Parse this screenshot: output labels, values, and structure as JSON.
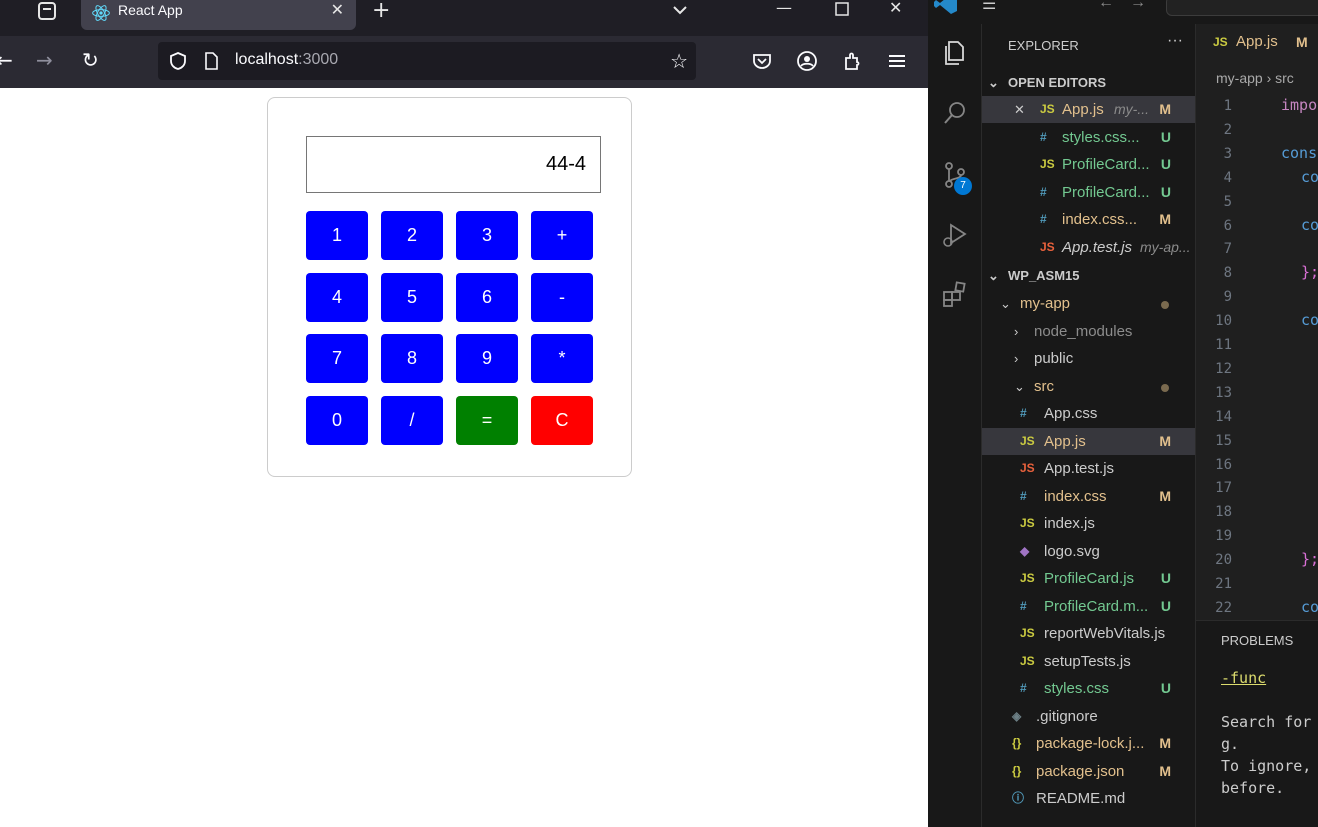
{
  "browser": {
    "tab_title": "React App",
    "url_host": "localhost",
    "url_port": ":3000"
  },
  "calculator": {
    "display_value": "44-4",
    "keys": [
      {
        "label": "1",
        "color": "#0000ff"
      },
      {
        "label": "2",
        "color": "#0000ff"
      },
      {
        "label": "3",
        "color": "#0000ff"
      },
      {
        "label": "+",
        "color": "#0000ff"
      },
      {
        "label": "4",
        "color": "#0000ff"
      },
      {
        "label": "5",
        "color": "#0000ff"
      },
      {
        "label": "6",
        "color": "#0000ff"
      },
      {
        "label": "-",
        "color": "#0000ff"
      },
      {
        "label": "7",
        "color": "#0000ff"
      },
      {
        "label": "8",
        "color": "#0000ff"
      },
      {
        "label": "9",
        "color": "#0000ff"
      },
      {
        "label": "*",
        "color": "#0000ff"
      },
      {
        "label": "0",
        "color": "#0000ff"
      },
      {
        "label": "/",
        "color": "#0000ff"
      },
      {
        "label": "=",
        "color": "#008000"
      },
      {
        "label": "C",
        "color": "#ff0000"
      }
    ]
  },
  "vscode": {
    "explorer_title": "EXPLORER",
    "source_control_badge": "7",
    "open_editors_header": "OPEN EDITORS",
    "open_editors": [
      {
        "close": "✕",
        "icon": "JS",
        "icon_color": "#cbcb41",
        "name": "App.js",
        "extra": "my-...",
        "status": "M",
        "name_color": "#e2c08d",
        "status_color": "#e2c08d"
      },
      {
        "close": "",
        "icon": "#",
        "icon_color": "#519aba",
        "name": "styles.css...",
        "extra": "",
        "status": "U",
        "name_color": "#73c991",
        "status_color": "#73c991"
      },
      {
        "close": "",
        "icon": "JS",
        "icon_color": "#cbcb41",
        "name": "ProfileCard...",
        "extra": "",
        "status": "U",
        "name_color": "#73c991",
        "status_color": "#73c991"
      },
      {
        "close": "",
        "icon": "#",
        "icon_color": "#519aba",
        "name": "ProfileCard...",
        "extra": "",
        "status": "U",
        "name_color": "#73c991",
        "status_color": "#73c991"
      },
      {
        "close": "",
        "icon": "#",
        "icon_color": "#519aba",
        "name": "index.css...",
        "extra": "",
        "status": "M",
        "name_color": "#e2c08d",
        "status_color": "#e2c08d"
      },
      {
        "close": "",
        "icon": "JS",
        "icon_color": "#e8613c",
        "name": "App.test.js",
        "extra": "my-ap...",
        "status": "",
        "name_color": "#cccccc",
        "status_color": "#cccccc"
      }
    ],
    "workspace_header": "WP_ASM15",
    "tree": [
      {
        "chev": "⌄",
        "icon": "",
        "icon_color": "#ccc",
        "name": "my-app",
        "status": "dot",
        "name_color": "#e2c08d",
        "indent": 1
      },
      {
        "chev": "›",
        "icon": "",
        "icon_color": "#ccc",
        "name": "node_modules",
        "status": "",
        "name_color": "#8c8c8c",
        "indent": 2
      },
      {
        "chev": "›",
        "icon": "",
        "icon_color": "#ccc",
        "name": "public",
        "status": "",
        "name_color": "#cccccc",
        "indent": 2
      },
      {
        "chev": "⌄",
        "icon": "",
        "icon_color": "#ccc",
        "name": "src",
        "status": "dot",
        "name_color": "#e2c08d",
        "indent": 2
      },
      {
        "chev": "",
        "icon": "#",
        "icon_color": "#519aba",
        "name": "App.css",
        "status": "",
        "name_color": "#cccccc",
        "indent": 3
      },
      {
        "chev": "",
        "icon": "JS",
        "icon_color": "#cbcb41",
        "name": "App.js",
        "status": "M",
        "name_color": "#e2c08d",
        "indent": 3
      },
      {
        "chev": "",
        "icon": "JS",
        "icon_color": "#e8613c",
        "name": "App.test.js",
        "status": "",
        "name_color": "#cccccc",
        "indent": 3
      },
      {
        "chev": "",
        "icon": "#",
        "icon_color": "#519aba",
        "name": "index.css",
        "status": "M",
        "name_color": "#e2c08d",
        "indent": 3
      },
      {
        "chev": "",
        "icon": "JS",
        "icon_color": "#cbcb41",
        "name": "index.js",
        "status": "",
        "name_color": "#cccccc",
        "indent": 3
      },
      {
        "chev": "",
        "icon": "◆",
        "icon_color": "#a074c4",
        "name": "logo.svg",
        "status": "",
        "name_color": "#cccccc",
        "indent": 3
      },
      {
        "chev": "",
        "icon": "JS",
        "icon_color": "#cbcb41",
        "name": "ProfileCard.js",
        "status": "U",
        "name_color": "#73c991",
        "indent": 3
      },
      {
        "chev": "",
        "icon": "#",
        "icon_color": "#519aba",
        "name": "ProfileCard.m...",
        "status": "U",
        "name_color": "#73c991",
        "indent": 3
      },
      {
        "chev": "",
        "icon": "JS",
        "icon_color": "#cbcb41",
        "name": "reportWebVitals.js",
        "status": "",
        "name_color": "#cccccc",
        "indent": 3
      },
      {
        "chev": "",
        "icon": "JS",
        "icon_color": "#cbcb41",
        "name": "setupTests.js",
        "status": "",
        "name_color": "#cccccc",
        "indent": 3
      },
      {
        "chev": "",
        "icon": "#",
        "icon_color": "#519aba",
        "name": "styles.css",
        "status": "U",
        "name_color": "#73c991",
        "indent": 3
      },
      {
        "chev": "",
        "icon": "◈",
        "icon_color": "#6d8086",
        "name": ".gitignore",
        "status": "",
        "name_color": "#cccccc",
        "indent": 2
      },
      {
        "chev": "",
        "icon": "{}",
        "icon_color": "#cbcb41",
        "name": "package-lock.j...",
        "status": "M",
        "name_color": "#e2c08d",
        "indent": 2
      },
      {
        "chev": "",
        "icon": "{}",
        "icon_color": "#cbcb41",
        "name": "package.json",
        "status": "M",
        "name_color": "#e2c08d",
        "indent": 2
      },
      {
        "chev": "",
        "icon": "ⓘ",
        "icon_color": "#519aba",
        "name": "README.md",
        "status": "",
        "name_color": "#cccccc",
        "indent": 2
      }
    ],
    "editor_tab": {
      "icon": "JS",
      "name": "App.js",
      "status": "M"
    },
    "breadcrumb": {
      "folder": "my-app",
      "sep": "›",
      "sub": "src"
    },
    "line_numbers": [
      "1",
      "2",
      "3",
      "4",
      "5",
      "6",
      "7",
      "8",
      "9",
      "10",
      "11",
      "12",
      "13",
      "14",
      "15",
      "16",
      "17",
      "18",
      "19",
      "20",
      "21",
      "22"
    ],
    "code_fragments": [
      {
        "line": 0,
        "text": "impo",
        "color": "#c586c0",
        "indent": 0
      },
      {
        "line": 2,
        "text": "cons",
        "color": "#569cd6",
        "indent": 0
      },
      {
        "line": 3,
        "text": "co",
        "color": "#569cd6",
        "indent": 1
      },
      {
        "line": 5,
        "text": "co",
        "color": "#569cd6",
        "indent": 1
      },
      {
        "line": 7,
        "text": "};",
        "color": "#da70d6",
        "indent": 1
      },
      {
        "line": 9,
        "text": "co",
        "color": "#569cd6",
        "indent": 1
      },
      {
        "line": 19,
        "text": "};",
        "color": "#da70d6",
        "indent": 1
      },
      {
        "line": 21,
        "text": "co",
        "color": "#569cd6",
        "indent": 1
      }
    ],
    "panel": {
      "title": "PROBLEMS",
      "lines": [
        "-func",
        "",
        "Search for",
        "g.",
        "To ignore,",
        "before."
      ]
    }
  }
}
